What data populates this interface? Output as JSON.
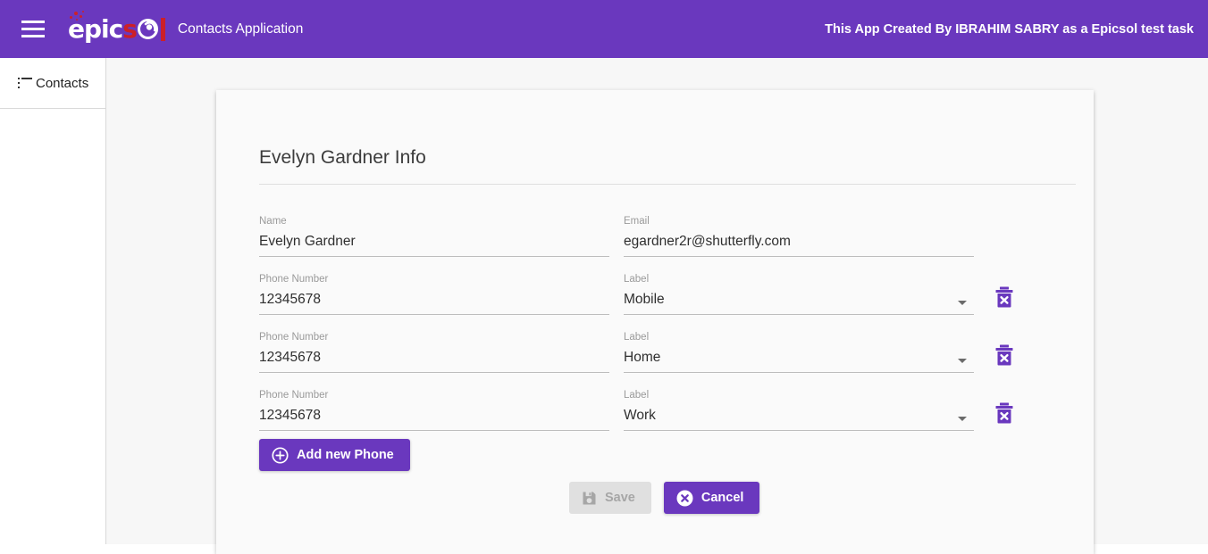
{
  "appbar": {
    "menu_icon": "hamburger-menu-icon",
    "logo": {
      "part1": "epic",
      "part2": "s",
      "part3": "o",
      "icon": "epicsol-logo"
    },
    "app_title": "Contacts Application",
    "credit": "This App Created By IBRAHIM SABRY as a Epicsol test task"
  },
  "sidebar": {
    "items": [
      {
        "label": "Contacts",
        "icon": "list-icon"
      }
    ]
  },
  "card": {
    "title": "Evelyn Gardner Info",
    "fields": {
      "name": {
        "label": "Name",
        "value": "Evelyn Gardner"
      },
      "email": {
        "label": "Email",
        "value": "egardner2r@shutterfly.com"
      }
    },
    "phones": [
      {
        "phone_label": "Phone Number",
        "phone_value": "12345678",
        "type_label": "Label",
        "type_value": "Mobile",
        "delete_icon": "trash-delete-icon"
      },
      {
        "phone_label": "Phone Number",
        "phone_value": "12345678",
        "type_label": "Label",
        "type_value": "Home",
        "delete_icon": "trash-delete-icon"
      },
      {
        "phone_label": "Phone Number",
        "phone_value": "12345678",
        "type_label": "Label",
        "type_value": "Work",
        "delete_icon": "trash-delete-icon"
      }
    ],
    "add_phone_button": {
      "label": "Add new Phone",
      "icon": "plus-circle-icon"
    },
    "save_button": {
      "label": "Save",
      "icon": "floppy-save-icon",
      "disabled": true
    },
    "cancel_button": {
      "label": "Cancel",
      "icon": "circle-x-icon"
    }
  },
  "colors": {
    "primary": "#6A38BE",
    "logo_red": "#CC2028",
    "page_bg": "#f7f7f7",
    "card_bg": "#fafafa",
    "disabled_bg": "#e0e0e0"
  }
}
